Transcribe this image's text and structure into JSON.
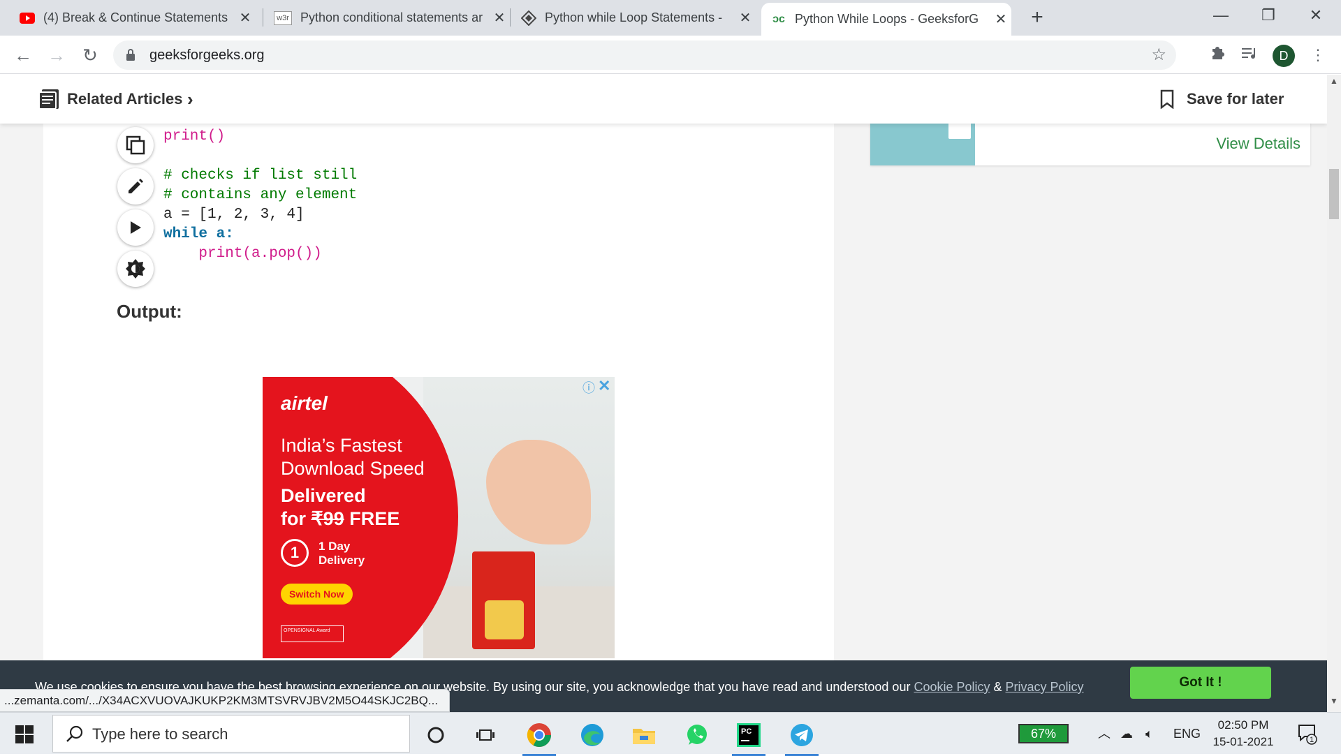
{
  "browser": {
    "tabs": [
      {
        "title": "(4) Break & Continue Statements",
        "favicon": "youtube-icon",
        "active": false
      },
      {
        "title": "Python conditional statements ar",
        "favicon": "w3resource-icon",
        "favicon_text": "w3r",
        "active": false
      },
      {
        "title": "Python while Loop Statements -",
        "favicon": "diamond-icon",
        "active": false
      },
      {
        "title": "Python While Loops - GeeksforG",
        "favicon": "geeksforgeeks-icon",
        "active": true
      }
    ],
    "new_tab_label": "+",
    "url": "geeksforgeeks.org",
    "profile_initial": "D"
  },
  "page": {
    "related_articles_label": "Related Articles",
    "save_for_later_label": "Save for later",
    "code_lines": [
      "print()",
      "",
      "# checks if list still",
      "# contains any element",
      "a = [1, 2, 3, 4]",
      "while a:",
      "    print(a.pop())"
    ],
    "output_label": "Output:",
    "sidebar_card": {
      "link_label": "View Details"
    },
    "ad": {
      "brand": "airtel",
      "headline": "India’s Fastest Download Speed",
      "offer_prefix": "Delivered",
      "offer_for": "for ",
      "offer_price": "₹99",
      "offer_free": " FREE",
      "delivery_number": "1",
      "delivery_text": "1 Day Delivery",
      "cta": "Switch Now",
      "award": "OPENSIGNAL Award"
    }
  },
  "cookie_bar": {
    "message": "We use cookies to ensure you have the best browsing experience on our website. By using our site, you acknowledge that you have read and understood our ",
    "cookie_policy": "Cookie Policy",
    "amp": " & ",
    "privacy_policy": "Privacy Policy",
    "button": "Got It !"
  },
  "status_url": "...zemanta.com/.../X34ACXVUOVAJKUKP2KM3MTSVRVJBV2M5O44SKJC2BQ...",
  "taskbar": {
    "search_placeholder": "Type here to search",
    "battery": "67%",
    "language": "ENG",
    "time": "02:50 PM",
    "date": "15-01-2021",
    "notification_count": "1"
  },
  "colors": {
    "gfg_green": "#2f8d46",
    "cookie_bg": "#2f3a44",
    "got_it": "#62d34d",
    "airtel_red": "#e4141d"
  }
}
